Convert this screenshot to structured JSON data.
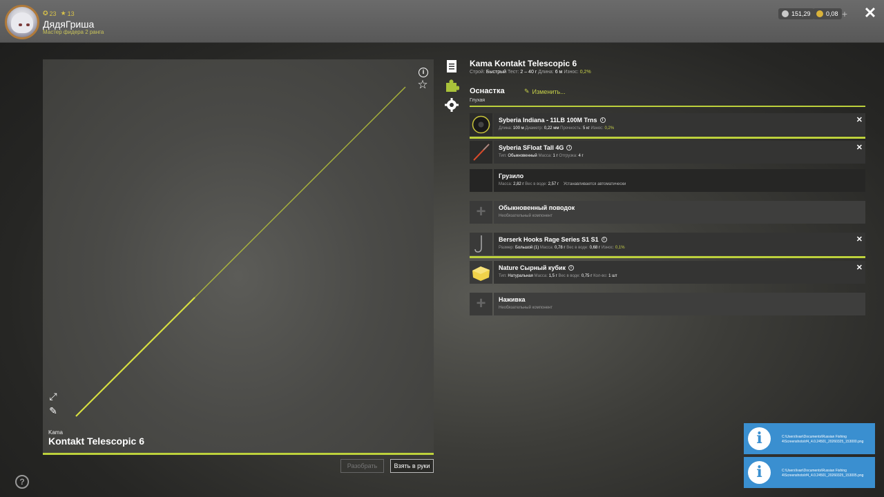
{
  "player": {
    "level": "23",
    "rank_level": "13",
    "name": "ДядяГриша",
    "rank_title": "Мастер фидера 2 ранга"
  },
  "currency": {
    "silver": "151,29",
    "gold": "0,08",
    "add_label": "+"
  },
  "rod": {
    "brand": "Kama",
    "model": "Kontakt Telescopic 6",
    "full_title": "Kama Kontakt Telescopic 6",
    "specs": {
      "action_label": "Строй:",
      "action_value": "Быстрый",
      "test_label": "Тест:",
      "test_value": "2 – 40 г",
      "length_label": "Длина:",
      "length_value": "6 м",
      "wear_label": "Износ:",
      "wear_value": "0,2%"
    }
  },
  "tackle": {
    "title": "Оснастка",
    "subtitle": "Глухая",
    "edit_label": "Изменить..."
  },
  "components": [
    {
      "name": "Syberia Indiana - 11LB 100M Trns",
      "props": [
        {
          "label": "Длина:",
          "value": "100 м"
        },
        {
          "label": "Диаметр:",
          "value": "0,22 мм"
        },
        {
          "label": "Прочность:",
          "value": "5 кг"
        },
        {
          "label": "Износ:",
          "value": "0,2%"
        }
      ]
    },
    {
      "name": "Syberia SFloat Tall 4G",
      "props": [
        {
          "label": "Тип:",
          "value": "Обыкновенный"
        },
        {
          "label": "Масса:",
          "value": "1 г"
        },
        {
          "label": "Отгрузка:",
          "value": "4 г"
        }
      ]
    },
    {
      "name": "Грузило",
      "props": [
        {
          "label": "Масса:",
          "value": "2,82 г"
        },
        {
          "label": "Вес в воде:",
          "value": "2,57 г"
        }
      ],
      "note": "Устанавливается автоматически"
    },
    {
      "name": "Обыкновенный поводок",
      "note": "Необязательный компонент"
    },
    {
      "name": "Berserk Hooks Rage Series S1 S1",
      "props": [
        {
          "label": "Размер:",
          "value": "Большой (1)"
        },
        {
          "label": "Масса:",
          "value": "0,78 г"
        },
        {
          "label": "Вес в воде:",
          "value": "0,68 г"
        },
        {
          "label": "Износ:",
          "value": "0,1%"
        }
      ]
    },
    {
      "name": "Nature Сырный кубик",
      "props": [
        {
          "label": "Тип:",
          "value": "Натуральная"
        },
        {
          "label": "Масса:",
          "value": "1,5 г"
        },
        {
          "label": "Вес в воде:",
          "value": "0,75 г"
        },
        {
          "label": "Кол-во:",
          "value": "1 шт"
        }
      ]
    },
    {
      "name": "Наживка",
      "note": "Необязательный компонент"
    }
  ],
  "actions": {
    "disassemble": "Разобрать",
    "take": "Взять в руки"
  },
  "notifications": [
    {
      "text": "C:\\Users\\Ivan\\Documents\\Russian Fishing 4\\Screenshots\\rf4_4.0.24501_20260325_153000.png"
    },
    {
      "text": "C:\\Users\\Ivan\\Documents\\Russian Fishing 4\\Screenshots\\rf4_4.0.24501_20260325_153005.png"
    }
  ],
  "colors": {
    "accent": "#bdd13c",
    "highlight_text": "#c9d24a",
    "notification": "#3a8fd0"
  }
}
